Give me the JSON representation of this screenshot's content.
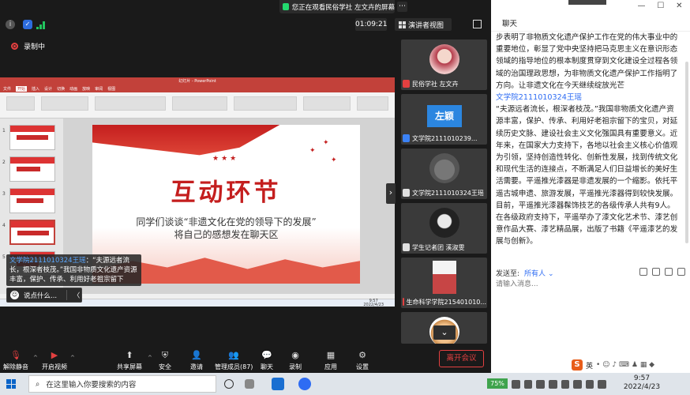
{
  "banner": {
    "text": "您正在观看民俗学社 左文卉的屏幕",
    "more": "⋯"
  },
  "top": {
    "timer": "01:09:21",
    "view_label": "演讲者视图",
    "recording": "录制中"
  },
  "slide": {
    "title": "互动环节",
    "subtitle_line1": "同学们谈谈“非遗文化在党的领导下的发展”",
    "subtitle_line2": "将自己的感想发在聊天区",
    "stars": "★★★",
    "ppt_tabs": [
      "文件",
      "开始",
      "插入",
      "设计",
      "切换",
      "动画",
      "放映",
      "审阅",
      "视图"
    ],
    "ppt_title": "幻灯片 - PowerPoint",
    "mini_time": "9:57",
    "mini_date": "2022/4/23"
  },
  "overlay": {
    "sender": "文学院2111010324王瑶",
    "message": "：“夫源远者流长，根深者枝茂。”我国非物质文化遗产资源丰富，保护、传承、利用好老祖宗留下",
    "say_label": "说点什么...",
    "collapse": "〈"
  },
  "participants": [
    {
      "name": "民俗学社 左文卉",
      "avatar": "girl",
      "avatar_text": ""
    },
    {
      "name": "文学院2111010239...",
      "avatar": "text",
      "avatar_text": "左颖"
    },
    {
      "name": "文学院2111010324王瑶",
      "avatar": "cartoon",
      "avatar_text": ""
    },
    {
      "name": "学生记者团 溪淑雯",
      "avatar": "dark",
      "avatar_text": ""
    },
    {
      "name": "生命科学学院215401010...",
      "avatar": "poster",
      "avatar_text": ""
    },
    {
      "name": "",
      "avatar": "monkey",
      "avatar_text": ""
    }
  ],
  "toolbar": {
    "items": [
      "解除静音",
      "开启视频",
      "共享屏幕",
      "安全",
      "邀请",
      "管理成员(87)",
      "聊天",
      "录制",
      "应用",
      "设置"
    ],
    "leave": "离开会议"
  },
  "chat": {
    "title": "聊天",
    "lines": [
      {
        "type": "text",
        "text": "步表明了非物质文化遗产保护工作在党的伟大事业中的重要地位，彰显了党中央坚持把马克思主义在意识形态领域的指导地位的根本制度贯穿到文化建设全过程各领域的治国理政思想，为非物质文化遗产保护工作指明了方向。让非遗文化在今天继续绽放光芒"
      },
      {
        "type": "sender",
        "text": "文学院2111010324王瑶"
      },
      {
        "type": "text",
        "text": "“夫源远者流长，根深者枝茂。”我国非物质文化遗产资源丰富，保护、传承、利用好老祖宗留下的宝贝，对延续历史文脉、建设社会主义文化强国具有重要意义。近年来，在国家大力支持下，各地以社会主义核心价值观为引领，坚持创造性转化、创新性发展，找到传统文化和现代生活的连接点，不断满足人们日益增长的美好生活需要。平遥推光漆器是非遗发展的一个缩影。依托平遥古城申遗、旅游发展，平遥推光漆器得到较快发展。目前，平遥推光漆器髹饰技艺的各级传承人共有9人。在各级政府支持下，平遥举办了漆文化艺术节、漆艺创意作品大赛、漆艺精品展，出版了书籍《平遥漆艺的发展与创新》。"
      }
    ],
    "send_label": "发送至:",
    "send_to": "所有人",
    "send_caret": "⌄",
    "input_placeholder": "请输入消息..."
  },
  "taskbar": {
    "search_placeholder": "在这里输入你要搜索的内容",
    "percent": "75%",
    "time": "9:57",
    "date": "2022/4/23",
    "ime": "英"
  },
  "colors": {
    "accent": "#2e6cf3",
    "danger": "#e34040",
    "ppt_red": "#c2413a"
  }
}
